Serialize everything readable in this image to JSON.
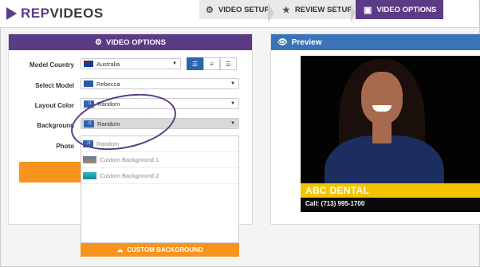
{
  "logo": {
    "rep": "REP",
    "videos": "VIDEOS"
  },
  "steps": [
    {
      "label": "VIDEO SETUP",
      "icon": "gears-icon"
    },
    {
      "label": "REVIEW SETUP",
      "icon": "star-icon"
    },
    {
      "label": "VIDEO OPTIONS",
      "icon": "video-icon",
      "active": true
    }
  ],
  "video_options": {
    "title": "VIDEO OPTIONS",
    "model_country": {
      "label": "Model Country",
      "value": "Australia"
    },
    "select_model": {
      "label": "Select Model",
      "value": "Rebecca"
    },
    "layout_color": {
      "label": "Layout Color",
      "value": "Random"
    },
    "background": {
      "label": "Background",
      "value": "Random"
    },
    "photo": {
      "label": "Photo"
    },
    "dropdown_options": [
      "Random",
      "Custom Background 1",
      "Custom Background 2"
    ],
    "custom_background_button": "CUSTOM BACKGROUND"
  },
  "preview": {
    "title": "Preview",
    "business_name": "ABC DENTAL",
    "call_text": "Call: (713) 995-1700"
  },
  "colors": {
    "brand_purple": "#5b3a86",
    "preview_blue": "#3a73b7",
    "accent_orange": "#f7941d",
    "banner_yellow": "#f5c400"
  }
}
